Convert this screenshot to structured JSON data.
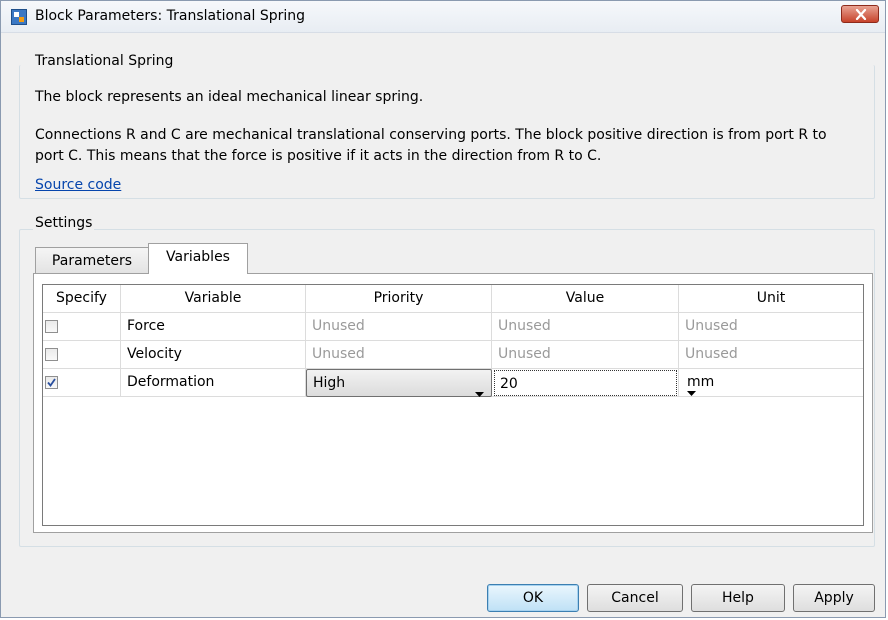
{
  "window": {
    "title": "Block Parameters: Translational Spring"
  },
  "description_group": {
    "label": "Translational Spring",
    "line1": "The block represents an ideal mechanical linear spring.",
    "line2": "Connections R and C are mechanical translational conserving ports. The block positive direction is from port R to",
    "line3": "port C. This means that the force is positive if it acts in the direction from R to C.",
    "source_link": "Source code"
  },
  "settings": {
    "label": "Settings",
    "tabs": [
      {
        "label": "Parameters",
        "active": false
      },
      {
        "label": "Variables",
        "active": true
      }
    ]
  },
  "table": {
    "headers": [
      "Specify",
      "Variable",
      "Priority",
      "Value",
      "Unit"
    ],
    "rows": [
      {
        "checked": false,
        "variable": "Force",
        "priority": "Unused",
        "value": "Unused",
        "unit": "Unused"
      },
      {
        "checked": false,
        "variable": "Velocity",
        "priority": "Unused",
        "value": "Unused",
        "unit": "Unused"
      },
      {
        "checked": true,
        "variable": "Deformation",
        "priority": "High",
        "value": "20",
        "unit": "mm"
      }
    ]
  },
  "buttons": {
    "ok": "OK",
    "cancel": "Cancel",
    "help": "Help",
    "apply": "Apply"
  },
  "colors": {
    "link": "#0645ad",
    "close_button": "#c7432b",
    "default_button": "#bfe1f6"
  }
}
